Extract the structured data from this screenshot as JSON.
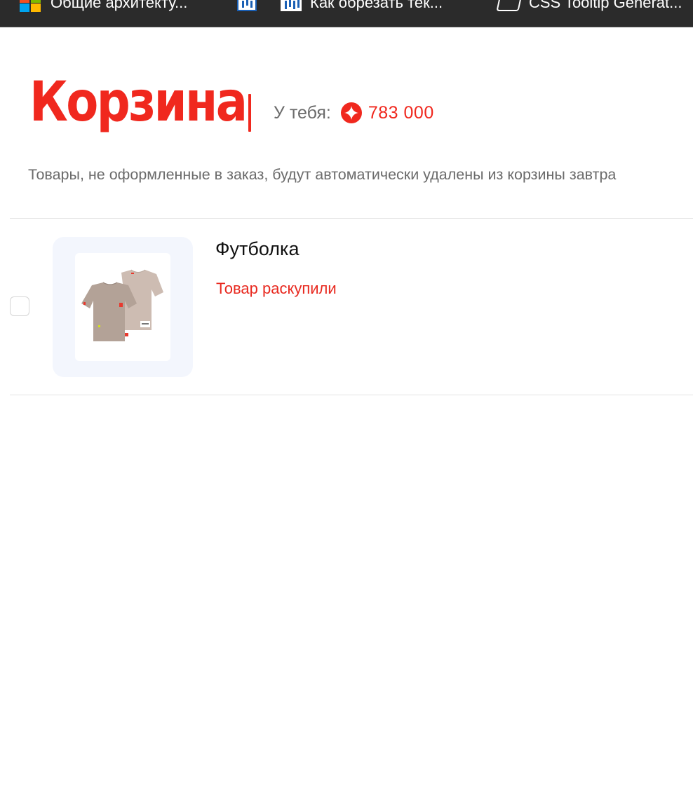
{
  "bookmarks": [
    {
      "label": "Общие архитекту...",
      "icon": "microsoft-icon"
    },
    {
      "label": "",
      "icon": "chart-icon"
    },
    {
      "label": "Как обрезать тек...",
      "icon": "chart-icon"
    },
    {
      "label": "CSS Tooltip Generat...",
      "icon": "css-icon"
    }
  ],
  "page": {
    "title": "Корзина",
    "balance_label": "У тебя:",
    "balance_value": "783 000",
    "note": "Товары, не оформленные в заказ, будут автоматически удалены из корзины завтра"
  },
  "cart": {
    "items": [
      {
        "name": "Футболка",
        "status": "Товар раскупили",
        "checked": false
      }
    ]
  },
  "colors": {
    "accent": "#f0281e",
    "muted_text": "#6b6b6b",
    "image_background": "#f3f6fd",
    "bookmarks_bar": "#2b2b2b"
  }
}
